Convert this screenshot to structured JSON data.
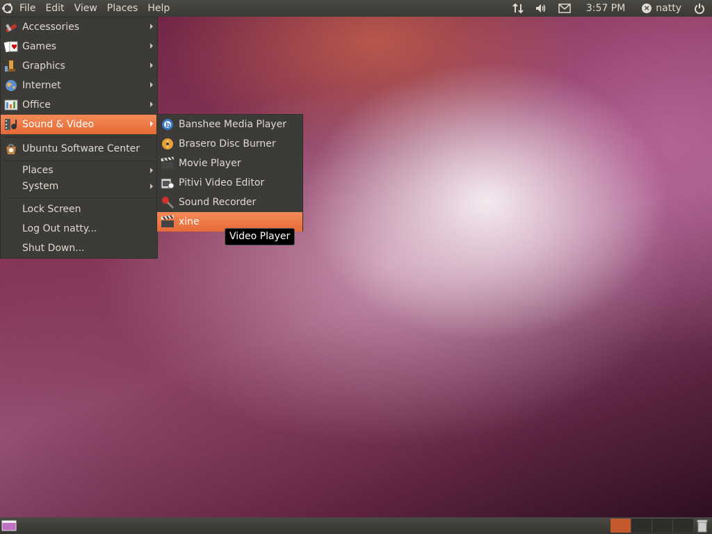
{
  "top_panel": {
    "menus": [
      "File",
      "Edit",
      "View",
      "Places",
      "Help"
    ],
    "tray": {
      "clock": "3:57 PM",
      "user": "natty"
    }
  },
  "apps_menu": {
    "items": [
      {
        "label": "Accessories",
        "submenu": true
      },
      {
        "label": "Games",
        "submenu": true
      },
      {
        "label": "Graphics",
        "submenu": true
      },
      {
        "label": "Internet",
        "submenu": true
      },
      {
        "label": "Office",
        "submenu": true
      },
      {
        "label": "Sound & Video",
        "submenu": true,
        "active": true
      },
      {
        "label": "Ubuntu Software Center",
        "submenu": false
      },
      {
        "label": "Places",
        "submenu": true
      },
      {
        "label": "System",
        "submenu": true
      },
      {
        "label": "Lock Screen",
        "submenu": false
      },
      {
        "label": "Log Out natty...",
        "submenu": false
      },
      {
        "label": "Shut Down...",
        "submenu": false
      }
    ]
  },
  "sound_video_menu": {
    "items": [
      {
        "label": "Banshee Media Player"
      },
      {
        "label": "Brasero Disc Burner"
      },
      {
        "label": "Movie Player"
      },
      {
        "label": "Pitivi Video Editor"
      },
      {
        "label": "Sound Recorder"
      },
      {
        "label": "xine",
        "active": true
      }
    ]
  },
  "tooltip": "Video Player",
  "colors": {
    "accent": "#e9713f",
    "panel": "#3c3b37",
    "text": "#dfdbd2"
  }
}
